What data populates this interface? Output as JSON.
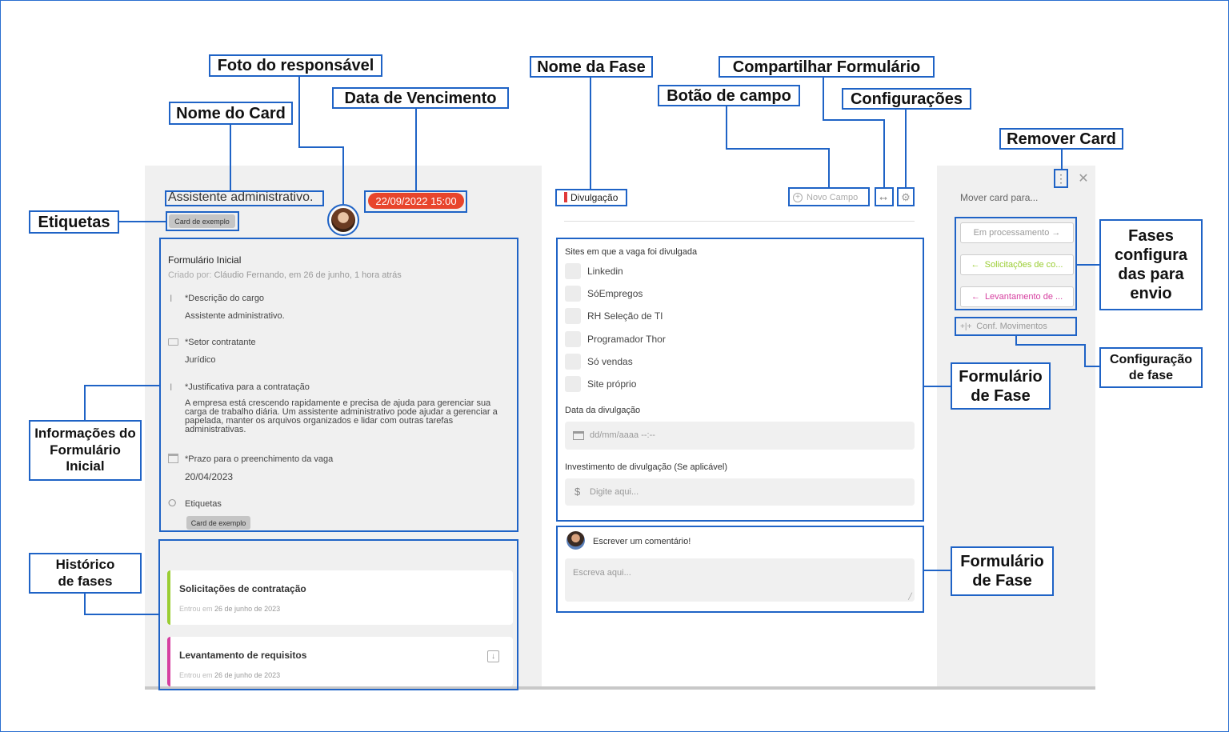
{
  "annotations": {
    "foto": "Foto do responsável",
    "nome_card": "Nome do Card",
    "data_venc": "Data de Vencimento",
    "nome_fase": "Nome da Fase",
    "compartilhar": "Compartilhar Formulário",
    "botao_campo": "Botão de campo",
    "configuracoes": "Configurações",
    "remover": "Remover Card",
    "etiquetas": "Etiquetas",
    "fases_config_1": "Fases",
    "fases_config_2": "configura",
    "fases_config_3": "das para",
    "fases_config_4": "envio",
    "config_fase_1": "Configuração",
    "config_fase_2": "de fase",
    "form_fase_a_1": "Formulário",
    "form_fase_a_2": "de Fase",
    "form_fase_b_1": "Formulário",
    "form_fase_b_2": "de Fase",
    "info_form_1": "Informações do",
    "info_form_2": "Formulário",
    "info_form_3": "Inicial",
    "historico_1": "Histórico",
    "historico_2": "de fases"
  },
  "card": {
    "title": "Assistente administrativo.",
    "due_date": "22/09/2022 15:00",
    "tag": "Card de exemplo"
  },
  "initial_form": {
    "title": "Formulário Inicial",
    "created_prefix": "Criado por: ",
    "created_by": "Cláudio Fernando, em 26 de junho, 1 hora atrás",
    "fields": [
      {
        "label": "*Descrição do cargo",
        "value": "Assistente administrativo."
      },
      {
        "label": "*Setor contratante",
        "value": "Jurídico"
      },
      {
        "label": "*Justificativa para a contratação",
        "value_lines": [
          "A empresa está crescendo rapidamente e precisa de ajuda para gerenciar sua",
          "carga de trabalho diária. Um assistente administrativo pode ajudar a gerenciar a",
          "papelada, manter os arquivos organizados e lidar com outras tarefas",
          "administrativas."
        ]
      },
      {
        "label": "*Prazo para o preenchimento da vaga",
        "value": "20/04/2023"
      },
      {
        "label": "Etiquetas",
        "value": "Card de exemplo"
      }
    ]
  },
  "history": [
    {
      "title": "Solicitações de contratação",
      "prefix": "Entrou em ",
      "date": "26 de junho de 2023",
      "color": "#9acd32"
    },
    {
      "title": "Levantamento de requisitos",
      "prefix": "Entrou em ",
      "date": "26 de junho de 2023",
      "color": "#d63fa0"
    }
  ],
  "phase": {
    "name": "Divulgação",
    "color": "#e03a3a",
    "new_field": "Novo Campo",
    "sites_label": "Sites em que a vaga foi divulgada",
    "sites": [
      "Linkedin",
      "SóEmpregos",
      "RH Seleção de TI",
      "Programador Thor",
      "Só vendas",
      "Site próprio"
    ],
    "date_label": "Data da divulgação",
    "date_placeholder": "dd/mm/aaaa --:--",
    "invest_label": "Investimento de divulgação (Se aplicável)",
    "invest_placeholder": "Digite aqui...",
    "currency": "$"
  },
  "comment": {
    "label": "Escrever um comentário!",
    "placeholder": "Escreva aqui..."
  },
  "move": {
    "title": "Mover card para...",
    "options": [
      {
        "label": "Em processamento",
        "arrow": "→",
        "color": "#999999"
      },
      {
        "label": "Solicitações de co...",
        "arrow": "←",
        "color": "#9acd32"
      },
      {
        "label": "Levantamento de ...",
        "arrow": "←",
        "color": "#d63fa0"
      }
    ],
    "conf_label": "Conf. Movimentos"
  },
  "colors": {
    "accent": "#1f63c6",
    "due": "#e8452c",
    "panel": "#f0f0f0"
  }
}
